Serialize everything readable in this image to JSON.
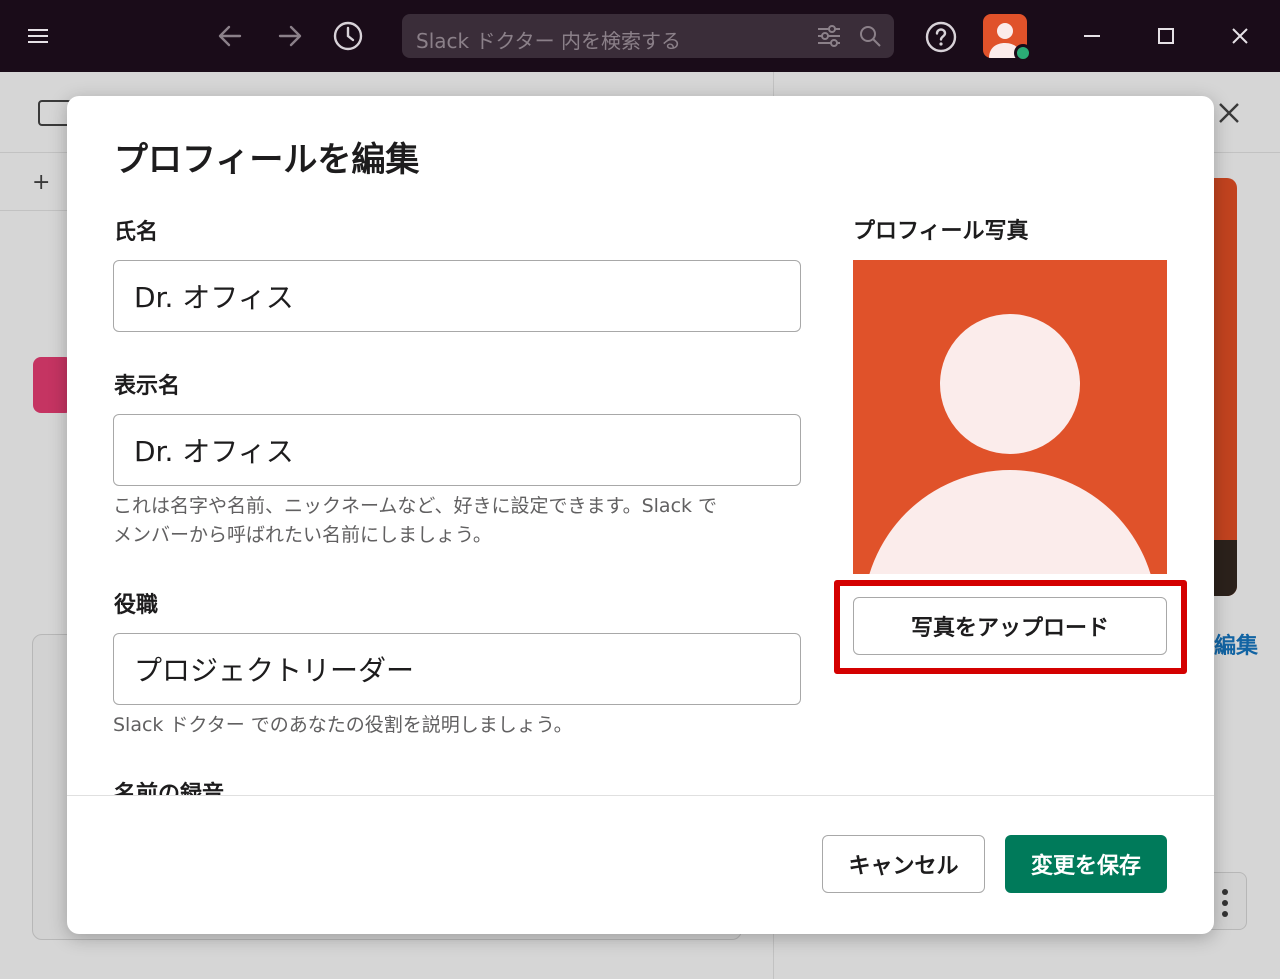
{
  "titlebar": {
    "search_placeholder": "Slack ドクター 内を検索する"
  },
  "background": {
    "right_edit_label": "編集"
  },
  "modal": {
    "title": "プロフィールを編集",
    "fields": {
      "full_name": {
        "label": "氏名",
        "value": "Dr. オフィス"
      },
      "display_name": {
        "label": "表示名",
        "value": "Dr. オフィス",
        "help_line1": "これは名字や名前、ニックネームなど、好きに設定できます。Slack で",
        "help_line2": "メンバーから呼ばれたい名前にしましょう。"
      },
      "title": {
        "label": "役職",
        "value": "プロジェクトリーダー",
        "help": "Slack ドクター でのあなたの役割を説明しましょう。"
      },
      "name_recording": {
        "label": "名前の録音"
      }
    },
    "photo": {
      "label": "プロフィール写真",
      "upload_button": "写真をアップロード"
    },
    "footer": {
      "cancel": "キャンセル",
      "save": "変更を保存"
    }
  },
  "colors": {
    "titlebar_bg": "#1a0c19",
    "avatar_bg": "#e0522a",
    "save_button_bg": "#007a5a",
    "highlight_border": "#d40000",
    "presence": "#2bac76"
  },
  "icons": [
    "hamburger-icon",
    "back-arrow-icon",
    "forward-arrow-icon",
    "history-icon",
    "filter-icon",
    "search-icon",
    "help-icon",
    "minimize-icon",
    "maximize-icon",
    "close-icon",
    "kebab-icon",
    "panel-icon",
    "plus-icon"
  ]
}
